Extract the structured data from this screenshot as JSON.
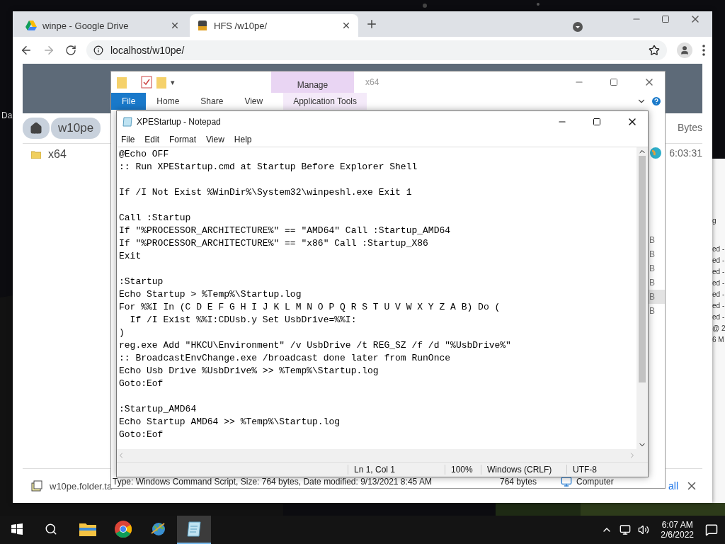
{
  "desktop": {
    "icon_label": "Da"
  },
  "browser": {
    "tabs": [
      {
        "title": "winpe - Google Drive",
        "selected": false
      },
      {
        "title": "HFS /w10pe/",
        "selected": true
      }
    ],
    "address": "localhost/w10pe/",
    "page": {
      "breadcrumbs": [
        "w10pe"
      ],
      "files": [
        {
          "name": "x64"
        }
      ],
      "size_header": "Bytes",
      "time": "6:03:31",
      "download": {
        "file": "w10pe.folder.ta",
        "show_all": "all"
      }
    }
  },
  "side_window": {
    "lines": [
      "g",
      "ed -",
      "ed -",
      "ed -",
      "ed -",
      "ed -",
      "ed -",
      "ed -",
      "@ 2",
      "6 M"
    ]
  },
  "explorer": {
    "quick_access": "▾",
    "context_tab": "Manage",
    "title": "x64",
    "ribbon_tabs": [
      {
        "label": "File",
        "kind": "file"
      },
      {
        "label": "Home",
        "kind": "tab"
      },
      {
        "label": "Share",
        "kind": "tab"
      },
      {
        "label": "View",
        "kind": "tab"
      },
      {
        "label": "Application Tools",
        "kind": "context"
      }
    ],
    "size_cells": [
      {
        "text": "B",
        "selected": false
      },
      {
        "text": "B",
        "selected": false
      },
      {
        "text": "B",
        "selected": false
      },
      {
        "text": "B",
        "selected": false
      },
      {
        "text": "B",
        "selected": true
      },
      {
        "text": "B",
        "selected": false
      }
    ],
    "status": {
      "details": "Type: Windows Command Script, Size: 764 bytes, Date modified: 9/13/2021 8:45 AM",
      "size": "764 bytes",
      "location": "Computer"
    }
  },
  "notepad": {
    "title": "XPEStartup - Notepad",
    "menu": [
      "File",
      "Edit",
      "Format",
      "View",
      "Help"
    ],
    "text": "@Echo OFF\n:: Run XPEStartup.cmd at Startup Before Explorer Shell\n\nIf /I Not Exist %WinDir%\\System32\\winpeshl.exe Exit 1\n\nCall :Startup\nIf \"%PROCESSOR_ARCHITECTURE%\" == \"AMD64\" Call :Startup_AMD64\nIf \"%PROCESSOR_ARCHITECTURE%\" == \"x86\" Call :Startup_X86\nExit\n\n:Startup\nEcho Startup > %Temp%\\Startup.log\nFor %%I In (C D E F G H I J K L M N O P Q R S T U V W X Y Z A B) Do (\n  If /I Exist %%I:CDUsb.y Set UsbDrive=%%I:\n)\nreg.exe Add \"HKCU\\Environment\" /v UsbDrive /t REG_SZ /f /d \"%UsbDrive%\"\n:: BroadcastEnvChange.exe /broadcast done later from RunOnce\nEcho Usb Drive %UsbDrive% >> %Temp%\\Startup.log\nGoto:Eof\n\n:Startup_AMD64\nEcho Startup AMD64 >> %Temp%\\Startup.log\nGoto:Eof",
    "status": [
      "Ln 1, Col 1",
      "100%",
      "Windows (CRLF)",
      "UTF-8"
    ]
  },
  "taskbar": {
    "apps": [
      {
        "kind": "explorer",
        "active": false
      },
      {
        "kind": "chrome",
        "active": false
      },
      {
        "kind": "globe",
        "active": false
      },
      {
        "kind": "notepad",
        "active": true
      }
    ],
    "time": "6:07 AM",
    "date": "2/6/2022"
  }
}
